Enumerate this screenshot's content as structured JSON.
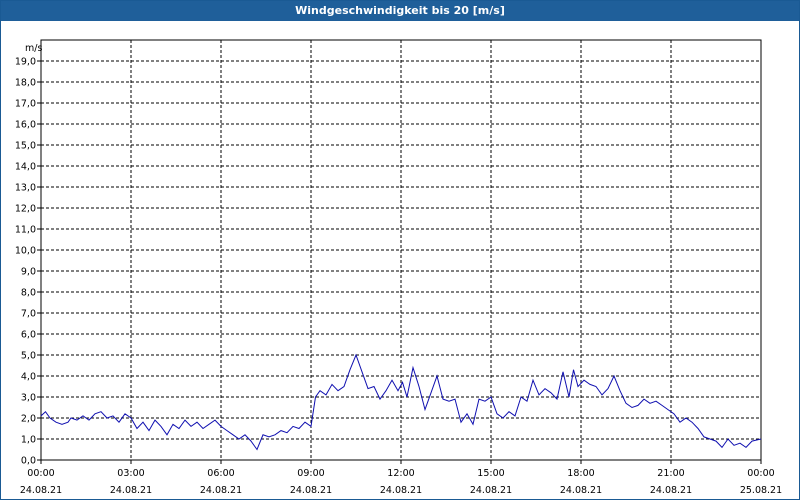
{
  "window": {
    "title": "Windgeschwindigkeit bis 20 [m/s]"
  },
  "colors": {
    "titlebar": "#1f5f9a",
    "series": "#1010b0",
    "grid": "#000000"
  },
  "chart_data": {
    "type": "line",
    "title": "Windgeschwindigkeit bis 20 [m/s]",
    "ylabel": "m/s",
    "xlabel": "",
    "ylim": [
      0,
      20
    ],
    "y_ticks": [
      "0,0",
      "1,0",
      "2,0",
      "3,0",
      "4,0",
      "5,0",
      "6,0",
      "7,0",
      "8,0",
      "9,0",
      "10,0",
      "11,0",
      "12,0",
      "13,0",
      "14,0",
      "15,0",
      "16,0",
      "17,0",
      "18,0",
      "19,0"
    ],
    "xlim_hours": [
      0,
      24
    ],
    "x_ticks": [
      {
        "time": "00:00",
        "date": "24.08.21"
      },
      {
        "time": "03:00",
        "date": "24.08.21"
      },
      {
        "time": "06:00",
        "date": "24.08.21"
      },
      {
        "time": "09:00",
        "date": "24.08.21"
      },
      {
        "time": "12:00",
        "date": "24.08.21"
      },
      {
        "time": "15:00",
        "date": "24.08.21"
      },
      {
        "time": "18:00",
        "date": "24.08.21"
      },
      {
        "time": "21:00",
        "date": "24.08.21"
      },
      {
        "time": "00:00",
        "date": "25.08.21"
      }
    ],
    "grid": true,
    "series": [
      {
        "x": [
          0.0,
          0.15,
          0.3,
          0.5,
          0.7,
          0.9,
          1.0,
          1.2,
          1.4,
          1.6,
          1.8,
          2.0,
          2.2,
          2.4,
          2.6,
          2.8,
          3.0,
          3.2,
          3.4,
          3.6,
          3.8,
          4.0,
          4.2,
          4.4,
          4.6,
          4.8,
          5.0,
          5.2,
          5.4,
          5.6,
          5.8,
          6.0,
          6.2,
          6.4,
          6.6,
          6.8,
          7.0,
          7.2,
          7.4,
          7.6,
          7.8,
          8.0,
          8.2,
          8.4,
          8.6,
          8.8,
          9.0,
          9.15,
          9.3,
          9.5,
          9.7,
          9.9,
          10.1,
          10.3,
          10.5,
          10.7,
          10.9,
          11.1,
          11.3,
          11.5,
          11.7,
          11.9,
          12.05,
          12.2,
          12.4,
          12.6,
          12.8,
          13.0,
          13.2,
          13.4,
          13.6,
          13.8,
          14.0,
          14.2,
          14.4,
          14.6,
          14.8,
          15.0,
          15.2,
          15.4,
          15.6,
          15.8,
          16.0,
          16.2,
          16.4,
          16.6,
          16.8,
          17.0,
          17.2,
          17.4,
          17.6,
          17.75,
          17.9,
          18.1,
          18.3,
          18.5,
          18.7,
          18.9,
          19.1,
          19.3,
          19.5,
          19.7,
          19.9,
          20.1,
          20.3,
          20.5,
          20.7,
          20.9,
          21.1,
          21.3,
          21.5,
          21.7,
          21.9,
          22.1,
          22.3,
          22.5,
          22.7,
          22.9,
          23.1,
          23.3,
          23.5,
          23.7,
          24.0
        ],
        "values": [
          2.1,
          2.3,
          2.0,
          1.8,
          1.7,
          1.8,
          2.0,
          1.9,
          2.1,
          1.9,
          2.2,
          2.3,
          2.0,
          2.1,
          1.8,
          2.2,
          2.0,
          1.5,
          1.8,
          1.4,
          1.9,
          1.6,
          1.2,
          1.7,
          1.5,
          1.9,
          1.6,
          1.8,
          1.5,
          1.7,
          1.9,
          1.6,
          1.4,
          1.2,
          1.0,
          1.2,
          0.9,
          0.5,
          1.2,
          1.1,
          1.2,
          1.4,
          1.3,
          1.6,
          1.5,
          1.8,
          1.6,
          3.0,
          3.3,
          3.1,
          3.6,
          3.3,
          3.5,
          4.3,
          5.0,
          4.2,
          3.4,
          3.5,
          2.9,
          3.3,
          3.8,
          3.3,
          3.7,
          3.0,
          4.4,
          3.5,
          2.4,
          3.2,
          4.0,
          2.9,
          2.8,
          2.9,
          1.8,
          2.2,
          1.7,
          2.9,
          2.8,
          3.0,
          2.2,
          2.0,
          2.3,
          2.1,
          3.0,
          2.8,
          3.8,
          3.1,
          3.4,
          3.2,
          2.9,
          4.2,
          3.0,
          4.3,
          3.5,
          3.8,
          3.6,
          3.5,
          3.1,
          3.4,
          4.0,
          3.3,
          2.7,
          2.5,
          2.6,
          2.9,
          2.7,
          2.8,
          2.6,
          2.4,
          2.2,
          1.8,
          2.0,
          1.8,
          1.5,
          1.1,
          1.0,
          0.9,
          0.6,
          1.0,
          0.7,
          0.8,
          0.6,
          0.9,
          1.0
        ]
      }
    ]
  }
}
